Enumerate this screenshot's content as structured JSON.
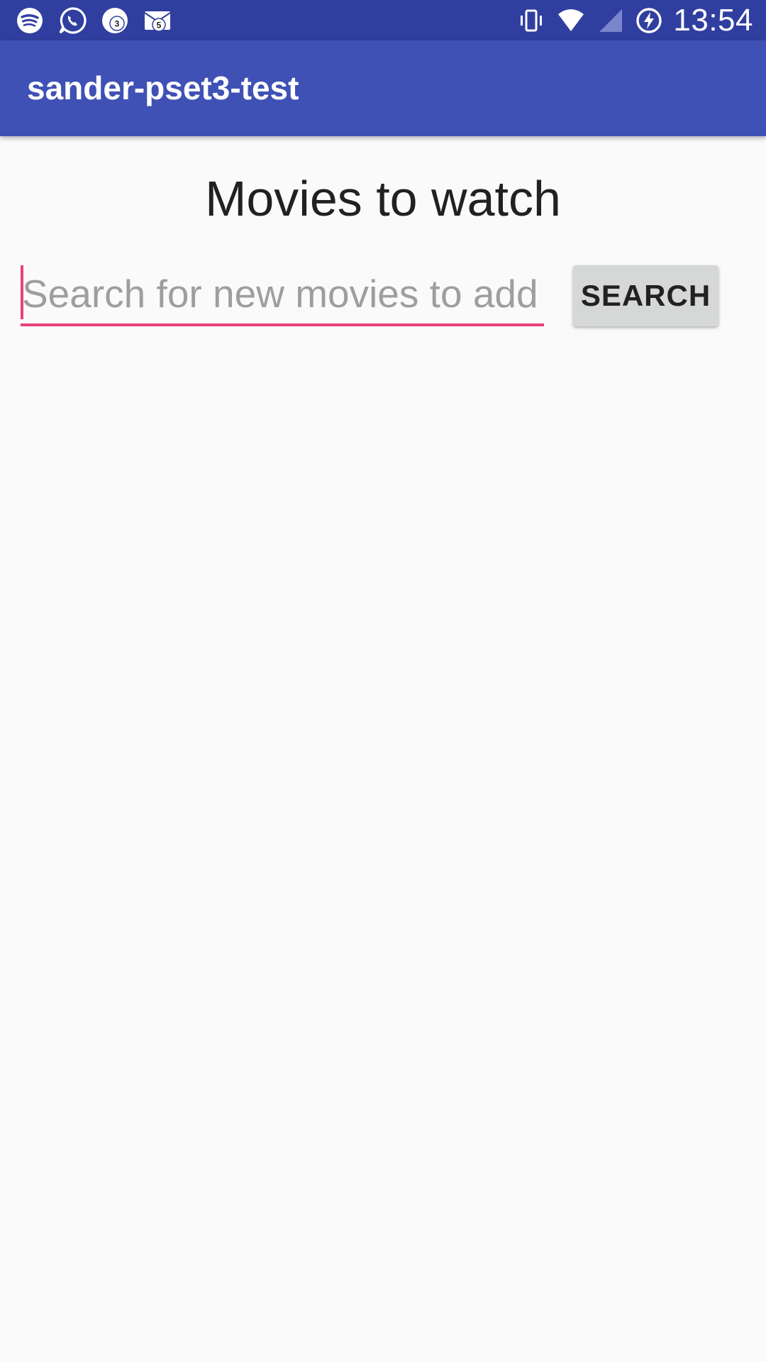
{
  "status_bar": {
    "time": "13:54",
    "notification_icons": [
      "spotify-icon",
      "whatsapp-icon",
      "badge-notification-icon",
      "mail-notification-icon"
    ],
    "badges": {
      "notification": "3",
      "mail": "5"
    },
    "system_icons": [
      "vibrate-icon",
      "wifi-icon",
      "cell-signal-icon",
      "battery-charging-icon"
    ],
    "colors": {
      "background": "#303f9f",
      "foreground": "#ffffff"
    }
  },
  "app_bar": {
    "title": "sander-pset3-test",
    "color": "#3f51b5"
  },
  "main": {
    "heading": "Movies to watch",
    "search": {
      "value": "",
      "placeholder": "Search for new movies to add",
      "accent_color": "#ec407a"
    },
    "search_button_label": "SEARCH"
  }
}
